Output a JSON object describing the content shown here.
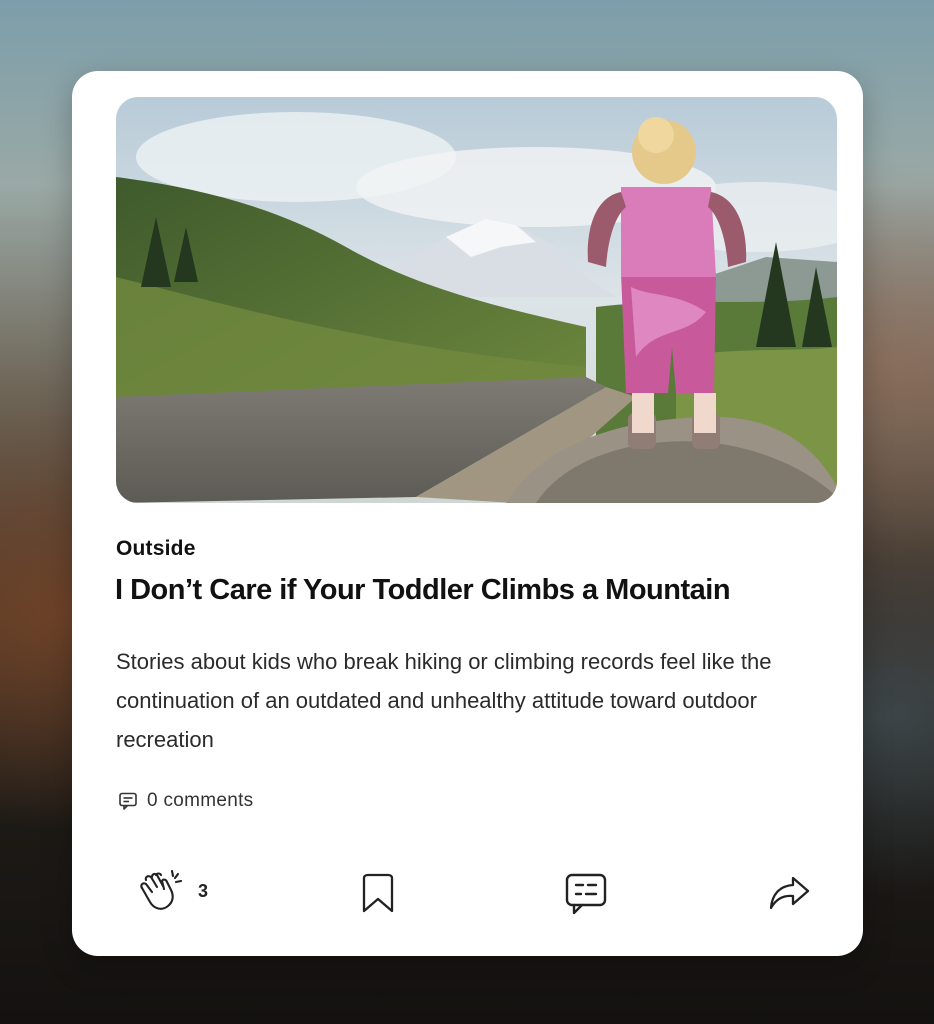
{
  "post": {
    "publication": "Outside",
    "title": "I Don’t Care if Your Toddler Climbs a Mountain",
    "excerpt": "Stories about kids who break hiking or climbing records feel like the continuation of an outdated and unhealthy attitude toward outdoor recreation",
    "image_alt": "Toddler in pink standing on a rock overlooking a mountain trail"
  },
  "meta": {
    "comments_label": "0 comments",
    "comments_icon": "comment-icon"
  },
  "actions": {
    "clap_icon": "clap-icon",
    "clap_count": "3",
    "bookmark_icon": "bookmark-icon",
    "reply_icon": "comment-bubble-icon",
    "share_icon": "share-arrow-icon"
  },
  "colors": {
    "card_bg": "#ffffff",
    "text_primary": "#111111",
    "text_secondary": "#2b2b2b"
  }
}
